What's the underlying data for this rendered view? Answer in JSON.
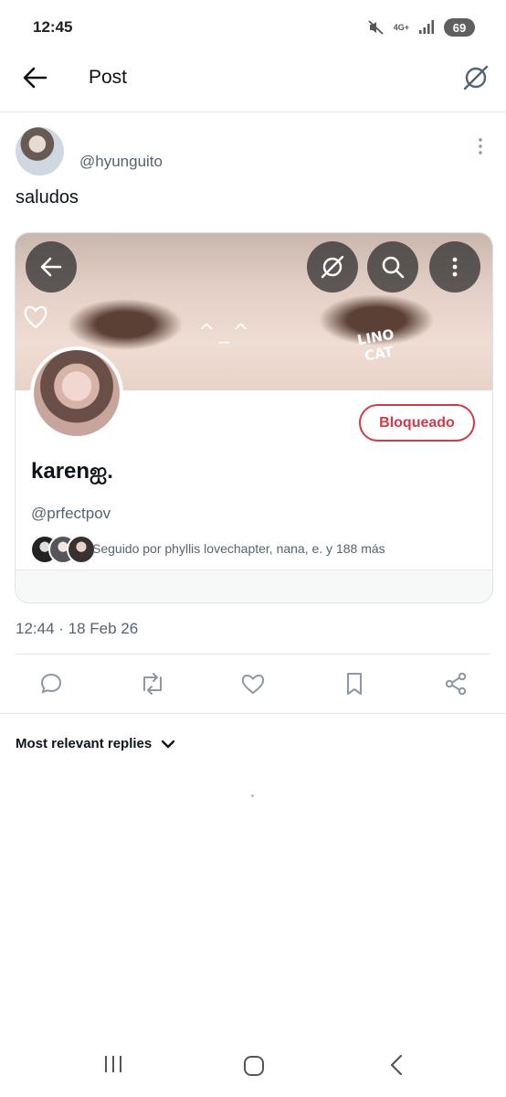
{
  "status_bar": {
    "time": "12:45",
    "network": "4G+",
    "battery": "69"
  },
  "header": {
    "title": "Post"
  },
  "post": {
    "author_handle": "@hyunguito",
    "text": "saludos",
    "timestamp": "12:44 · 18 Feb 26"
  },
  "embedded_profile": {
    "banner_doodle": "^_^",
    "banner_caption_line1": "LINO",
    "banner_caption_line2": "CAT",
    "name": "karenஐ.",
    "handle": "@prfectpov",
    "block_button_label": "Bloqueado",
    "followed_by": "Seguido por phyllis lovechapter, nana, e. y 188 más"
  },
  "actions": [
    "reply-icon",
    "repost-icon",
    "like-icon",
    "bookmark-icon",
    "share-icon"
  ],
  "replies_filter": {
    "label": "Most relevant replies"
  },
  "colors": {
    "blocked": "#d23a47",
    "muted_text": "#536471",
    "icon_gray": "#8b98a5"
  }
}
